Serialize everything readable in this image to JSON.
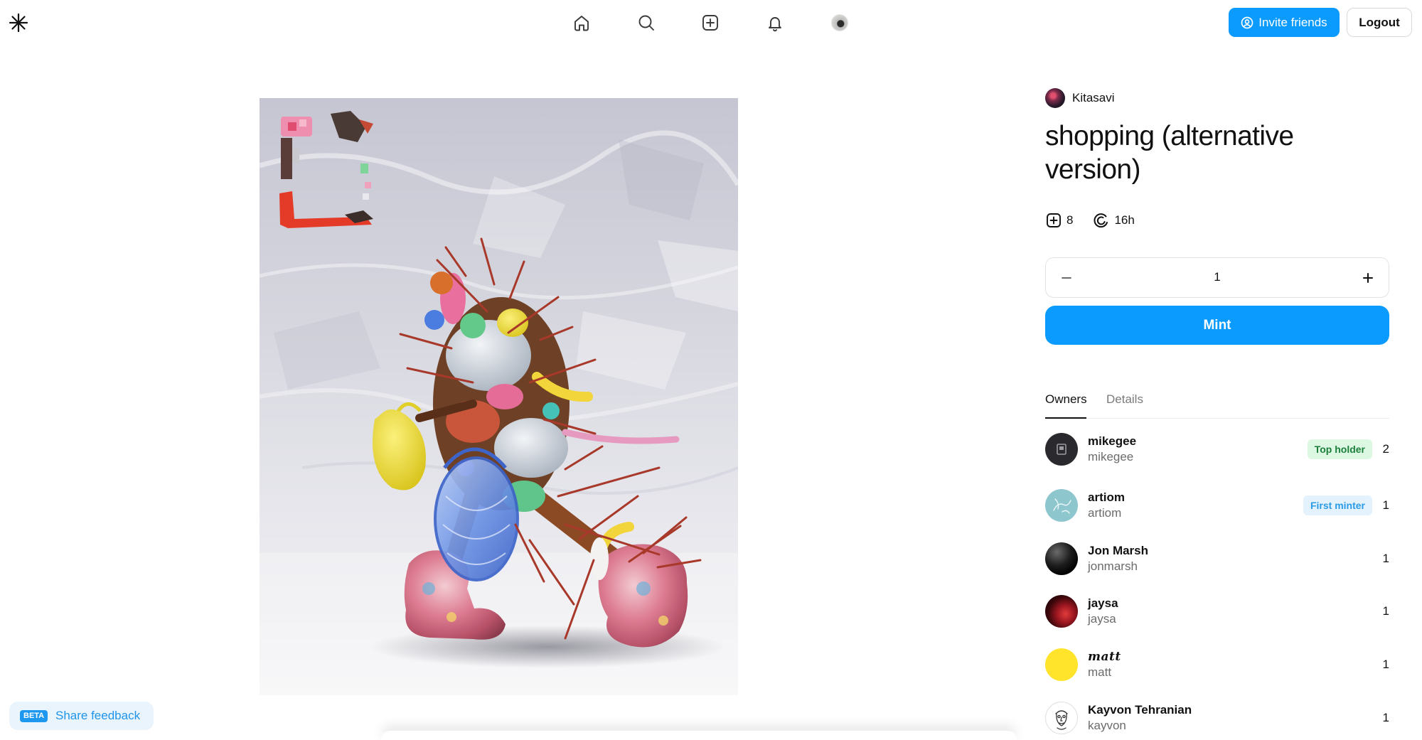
{
  "header": {
    "logo_icon": "asterisk-logo-icon",
    "nav_icons": [
      "home-icon",
      "search-icon",
      "create-icon",
      "notifications-icon",
      "profile-avatar"
    ],
    "invite_label": "Invite friends",
    "logout_label": "Logout"
  },
  "artwork": {
    "artist": "Kitasavi",
    "title": "shopping (alternative version)",
    "mint_count": "8",
    "time_left": "16h"
  },
  "mint": {
    "quantity": "1",
    "button_label": "Mint"
  },
  "tabs": {
    "owners": "Owners",
    "details": "Details",
    "active": "Owners"
  },
  "owners": [
    {
      "name": "mikegee",
      "handle": "mikegee",
      "badge": "Top holder",
      "count": "2"
    },
    {
      "name": "artiom",
      "handle": "artiom",
      "badge": "First minter",
      "count": "1"
    },
    {
      "name": "Jon Marsh",
      "handle": "jonmarsh",
      "badge": null,
      "count": "1"
    },
    {
      "name": "jaysa",
      "handle": "jaysa",
      "badge": null,
      "count": "1"
    },
    {
      "name": "matt",
      "handle": "matt",
      "badge": null,
      "count": "1"
    },
    {
      "name": "Kayvon Tehranian",
      "handle": "kayvon",
      "badge": null,
      "count": "1"
    }
  ],
  "feedback": {
    "badge": "BETA",
    "label": "Share feedback"
  },
  "colors": {
    "accent": "#0B9BFF",
    "top_holder_bg": "#DDF8E2",
    "top_holder_text": "#1B7F3A",
    "first_minter_bg": "#E3F2FD",
    "first_minter_text": "#2A9BE6",
    "feedback_bg": "#EAF4FD"
  }
}
